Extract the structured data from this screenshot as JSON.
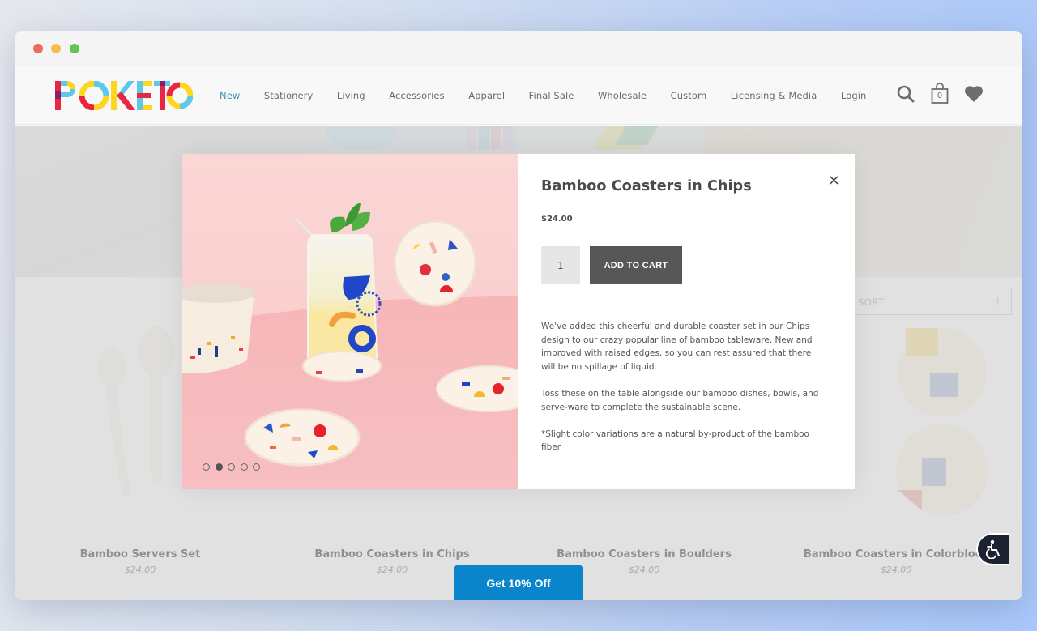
{
  "window": {
    "controls": [
      "close",
      "minimize",
      "maximize"
    ]
  },
  "header": {
    "logo": {
      "text": "POKETO",
      "letters": [
        "P",
        "O",
        "K",
        "E",
        "T",
        "O"
      ]
    },
    "nav": [
      {
        "label": "New",
        "active": true
      },
      {
        "label": "Stationery",
        "active": false
      },
      {
        "label": "Living",
        "active": false
      },
      {
        "label": "Accessories",
        "active": false
      },
      {
        "label": "Apparel",
        "active": false
      },
      {
        "label": "Final Sale",
        "active": false
      },
      {
        "label": "Wholesale",
        "active": false
      },
      {
        "label": "Custom",
        "active": false
      },
      {
        "label": "Licensing & Media",
        "active": false
      },
      {
        "label": "Login",
        "active": false
      }
    ],
    "icons": {
      "search": "search-icon",
      "cart": "shopping-bag-icon",
      "wishlist": "heart-icon"
    },
    "cart_count": "0",
    "accent": "#3a8fb7"
  },
  "collection": {
    "sort_label": "SORT",
    "sort_icon": "+",
    "products": [
      {
        "title": "Bamboo Servers Set",
        "price": "$24.00"
      },
      {
        "title": "Bamboo Coasters in Chips",
        "price": "$24.00"
      },
      {
        "title": "Bamboo Coasters in Boulders",
        "price": "$24.00"
      },
      {
        "title": "Bamboo Coasters in Colorblock",
        "price": "$24.00"
      }
    ]
  },
  "modal": {
    "title": "Bamboo Coasters in Chips",
    "close": "×",
    "price": "$24.00",
    "quantity": "1",
    "add_to_cart": "ADD TO CART",
    "description": [
      "We've added this cheerful and durable coaster set in our Chips design to our crazy popular line of bamboo tableware. New and improved with raised edges, so you can rest assured that there will be no spillage of liquid.",
      "Toss these on the table alongside our bamboo dishes, bowls, and serve-ware to complete the sustainable scene.",
      "*Slight color variations are a natural by-product of the bamboo fiber"
    ],
    "image_alt": "Bamboo coasters with colorful chip pattern beside a drink glass and bowl on pink background",
    "carousel": {
      "total": 5,
      "active_index": 1
    }
  },
  "promo": {
    "label": "Get 10% Off",
    "color": "#0a85cc"
  },
  "accessibility": {
    "icon": "accessibility-icon"
  }
}
